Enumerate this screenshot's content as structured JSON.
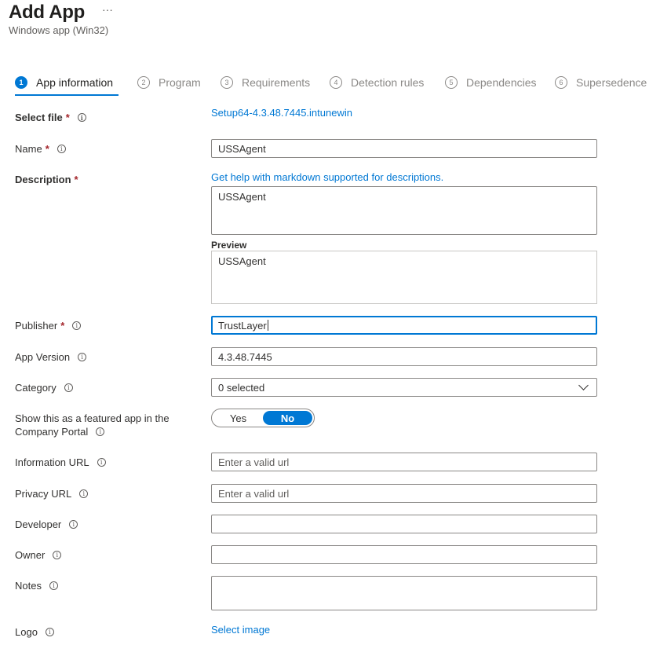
{
  "header": {
    "title": "Add App",
    "more": "···",
    "subtitle": "Windows app (Win32)"
  },
  "steps": [
    {
      "num": "1",
      "label": "App information",
      "active": true
    },
    {
      "num": "2",
      "label": "Program"
    },
    {
      "num": "3",
      "label": "Requirements"
    },
    {
      "num": "4",
      "label": "Detection rules"
    },
    {
      "num": "5",
      "label": "Dependencies"
    },
    {
      "num": "6",
      "label": "Supersedence"
    }
  ],
  "form": {
    "select_file": {
      "label": "Select file",
      "required": "*",
      "value": "Setup64-4.3.48.7445.intunewin"
    },
    "name": {
      "label": "Name",
      "required": "*",
      "value": "USSAgent"
    },
    "description": {
      "label": "Description",
      "required": "*",
      "help_link": "Get help with markdown supported for descriptions.",
      "value": "USSAgent",
      "preview_label": "Preview",
      "preview_value": "USSAgent"
    },
    "publisher": {
      "label": "Publisher",
      "required": "*",
      "value": "TrustLayer"
    },
    "app_version": {
      "label": "App Version",
      "value": "4.3.48.7445"
    },
    "category": {
      "label": "Category",
      "value": "0 selected"
    },
    "featured": {
      "label_line1": "Show this as a featured app in the",
      "label_line2": "Company Portal",
      "yes": "Yes",
      "no": "No",
      "selected": "No"
    },
    "information_url": {
      "label": "Information URL",
      "placeholder": "Enter a valid url"
    },
    "privacy_url": {
      "label": "Privacy URL",
      "placeholder": "Enter a valid url"
    },
    "developer": {
      "label": "Developer",
      "value": ""
    },
    "owner": {
      "label": "Owner",
      "value": ""
    },
    "notes": {
      "label": "Notes",
      "value": ""
    },
    "logo": {
      "label": "Logo",
      "link": "Select image"
    }
  },
  "icons": {
    "info": "i",
    "info_name": "info-icon",
    "chevron_name": "chevron-down-icon"
  },
  "colors": {
    "accent": "#0078d4",
    "required": "#a4262c",
    "text": "#323130"
  }
}
